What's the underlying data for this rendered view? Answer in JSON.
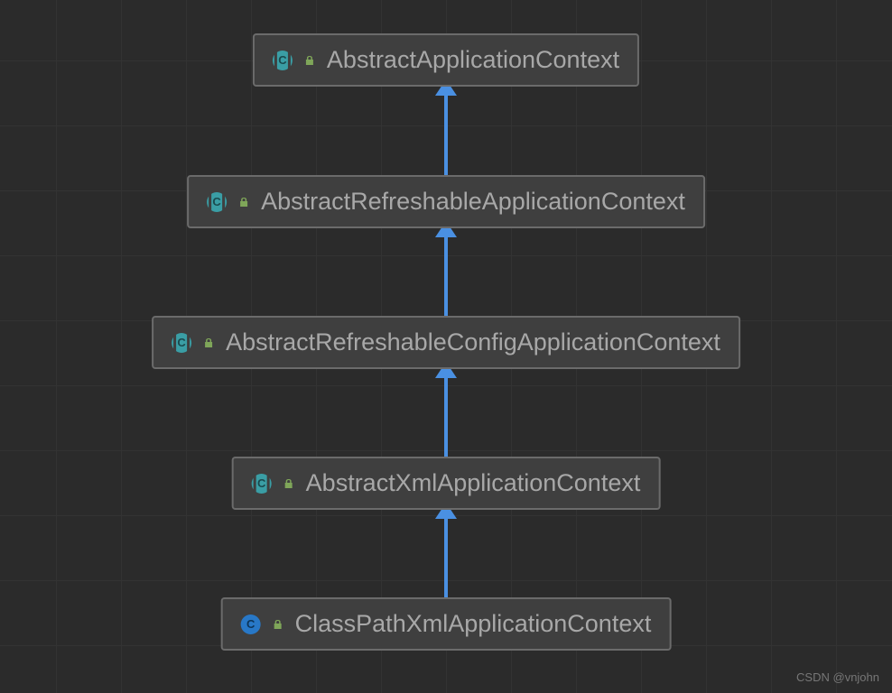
{
  "nodes": [
    {
      "label": "AbstractApplicationContext",
      "abstract": true,
      "locked": true
    },
    {
      "label": "AbstractRefreshableApplicationContext",
      "abstract": true,
      "locked": true
    },
    {
      "label": "AbstractRefreshableConfigApplicationContext",
      "abstract": true,
      "locked": true
    },
    {
      "label": "AbstractXmlApplicationContext",
      "abstract": true,
      "locked": true
    },
    {
      "label": "ClassPathXmlApplicationContext",
      "abstract": false,
      "locked": true
    }
  ],
  "watermark": "CSDN @vnjohn",
  "colors": {
    "arrow": "#4a90e2",
    "box_bg": "#3f3f3f",
    "box_border": "#6b6b6b",
    "text": "#a8a8a8",
    "lock": "#7fa659"
  }
}
